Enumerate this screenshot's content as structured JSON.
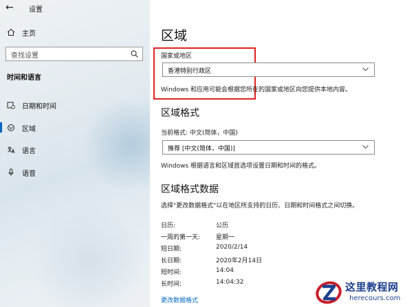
{
  "window": {
    "title": "设置"
  },
  "sidebar": {
    "home_label": "主页",
    "search_placeholder": "查找设置",
    "section_title": "时间和语言",
    "items": [
      {
        "label": "日期和时间",
        "icon": "calendar-clock-icon"
      },
      {
        "label": "区域",
        "icon": "region-globe-icon",
        "active": true
      },
      {
        "label": "语言",
        "icon": "language-icon"
      },
      {
        "label": "语音",
        "icon": "microphone-icon"
      }
    ]
  },
  "main": {
    "page_title": "区域",
    "country": {
      "label": "国家或地区",
      "selected": "香港特别行政区",
      "description": "Windows 和应用可能会根据您所在的国家或地区向您提供本地内容。"
    },
    "format": {
      "heading": "区域格式",
      "current_label": "当前格式: 中文(简体，中国)",
      "selected": "推荐 [中文(简体，中国)]",
      "description": "Windows 根据语言和区域首选项设置日期和时间的格式。"
    },
    "format_data": {
      "heading": "区域格式数据",
      "description": "选择\"更改数据格式\"以在地区所支持的日历、日期和时间格式之间切换。",
      "rows": [
        {
          "label": "日历:",
          "value": "公历"
        },
        {
          "label": "一周的第一天:",
          "value": "星期一"
        },
        {
          "label": "短日期:",
          "value": "2020/2/14"
        },
        {
          "label": "长日期:",
          "value": "2020年2月14日"
        },
        {
          "label": "短时间:",
          "value": "14:04"
        },
        {
          "label": "长时间:",
          "value": "14:04:32"
        }
      ],
      "change_link": "更改数据格式"
    }
  },
  "watermark": {
    "cn": "这里教程网",
    "en": "herecours.com"
  },
  "colors": {
    "accent": "#0067c0",
    "highlight": "#e02020",
    "watermark": "#1d3f8c"
  }
}
